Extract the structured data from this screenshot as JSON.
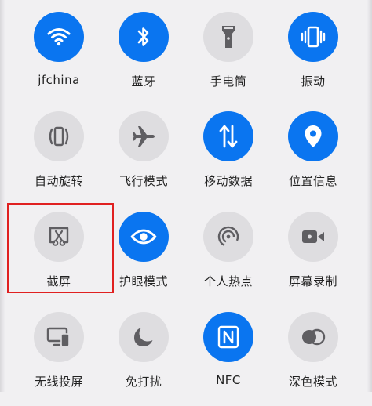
{
  "tiles": [
    {
      "label": "jfchina",
      "icon": "wifi-icon",
      "state": "on"
    },
    {
      "label": "蓝牙",
      "icon": "bluetooth-icon",
      "state": "on"
    },
    {
      "label": "手电筒",
      "icon": "flashlight-icon",
      "state": "off"
    },
    {
      "label": "振动",
      "icon": "vibrate-icon",
      "state": "on"
    },
    {
      "label": "自动旋转",
      "icon": "auto-rotate-icon",
      "state": "off"
    },
    {
      "label": "飞行模式",
      "icon": "airplane-icon",
      "state": "off"
    },
    {
      "label": "移动数据",
      "icon": "mobile-data-icon",
      "state": "on"
    },
    {
      "label": "位置信息",
      "icon": "location-icon",
      "state": "on"
    },
    {
      "label": "截屏",
      "icon": "screenshot-icon",
      "state": "off"
    },
    {
      "label": "护眼模式",
      "icon": "eye-icon",
      "state": "on"
    },
    {
      "label": "个人热点",
      "icon": "hotspot-icon",
      "state": "off"
    },
    {
      "label": "屏幕录制",
      "icon": "screen-record-icon",
      "state": "off"
    },
    {
      "label": "无线投屏",
      "icon": "wireless-projection-icon",
      "state": "off"
    },
    {
      "label": "免打扰",
      "icon": "moon-icon",
      "state": "off"
    },
    {
      "label": "NFC",
      "icon": "nfc-icon",
      "state": "on"
    },
    {
      "label": "深色模式",
      "icon": "dark-mode-icon",
      "state": "off"
    }
  ],
  "colors": {
    "active": "#0a75f0",
    "inactive": "#dedde0",
    "icon_inactive": "#5f5e62",
    "highlight": "#e02020",
    "background": "#f1f0f2"
  }
}
